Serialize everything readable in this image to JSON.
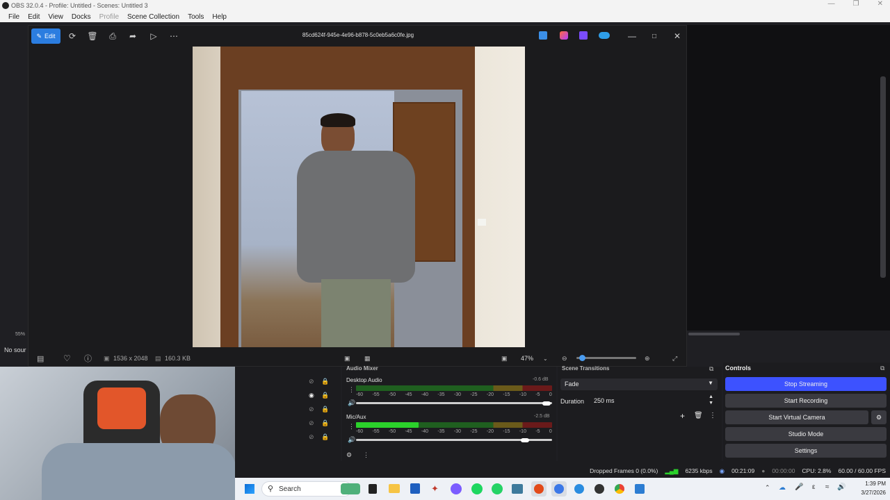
{
  "obs": {
    "title": "OBS 32.0.4 - Profile: Untitled - Scenes: Untitled 3",
    "menu": [
      "File",
      "Edit",
      "View",
      "Docks",
      "Profile",
      "Scene Collection",
      "Tools",
      "Help"
    ],
    "zoom_small": "55%",
    "no_source": "No sour"
  },
  "viewer": {
    "edit_label": "Edit",
    "file_name": "85cd624f-945e-4e96-b878-5c0eb5a6c0fe.jpg",
    "dimensions": "1536 x 2048",
    "file_size": "160.3 KB",
    "zoom": "47%",
    "zoom_fraction": 0.05
  },
  "audio_mixer": {
    "title": "Audio Mixer",
    "tracks": [
      {
        "name": "Desktop Audio",
        "db": "-0.6 dB",
        "level": 0.0,
        "volume": 0.97
      },
      {
        "name": "Mic/Aux",
        "db": "-2.5 dB",
        "level": 0.32,
        "volume": 0.86
      }
    ],
    "scale": [
      "-60",
      "-55",
      "-50",
      "-45",
      "-40",
      "-35",
      "-30",
      "-25",
      "-20",
      "-15",
      "-10",
      "-5",
      "0"
    ]
  },
  "transitions": {
    "title": "Scene Transitions",
    "selected": "Fade",
    "duration_label": "Duration",
    "duration_value": "250 ms"
  },
  "controls": {
    "title": "Controls",
    "stop_streaming": "Stop Streaming",
    "start_recording": "Start Recording",
    "start_virtual_camera": "Start Virtual Camera",
    "studio_mode": "Studio Mode",
    "settings": "Settings"
  },
  "status": {
    "dropped_frames": "Dropped Frames 0 (0.0%)",
    "bitrate": "6235 kbps",
    "stream_time": "00:21:09",
    "record_time": "00:00:00",
    "cpu": "CPU: 2.8%",
    "fps": "60.00 / 60.00 FPS"
  },
  "taskbar": {
    "search_placeholder": "Search",
    "time": "1:39 PM",
    "date": "3/27/2026"
  },
  "colors": {
    "accent": "#2b7de0",
    "stop_streaming": "#3d52ff",
    "meter_green": "#2bd12b",
    "meter_yellow": "#c9b12a",
    "meter_red": "#c42929"
  }
}
